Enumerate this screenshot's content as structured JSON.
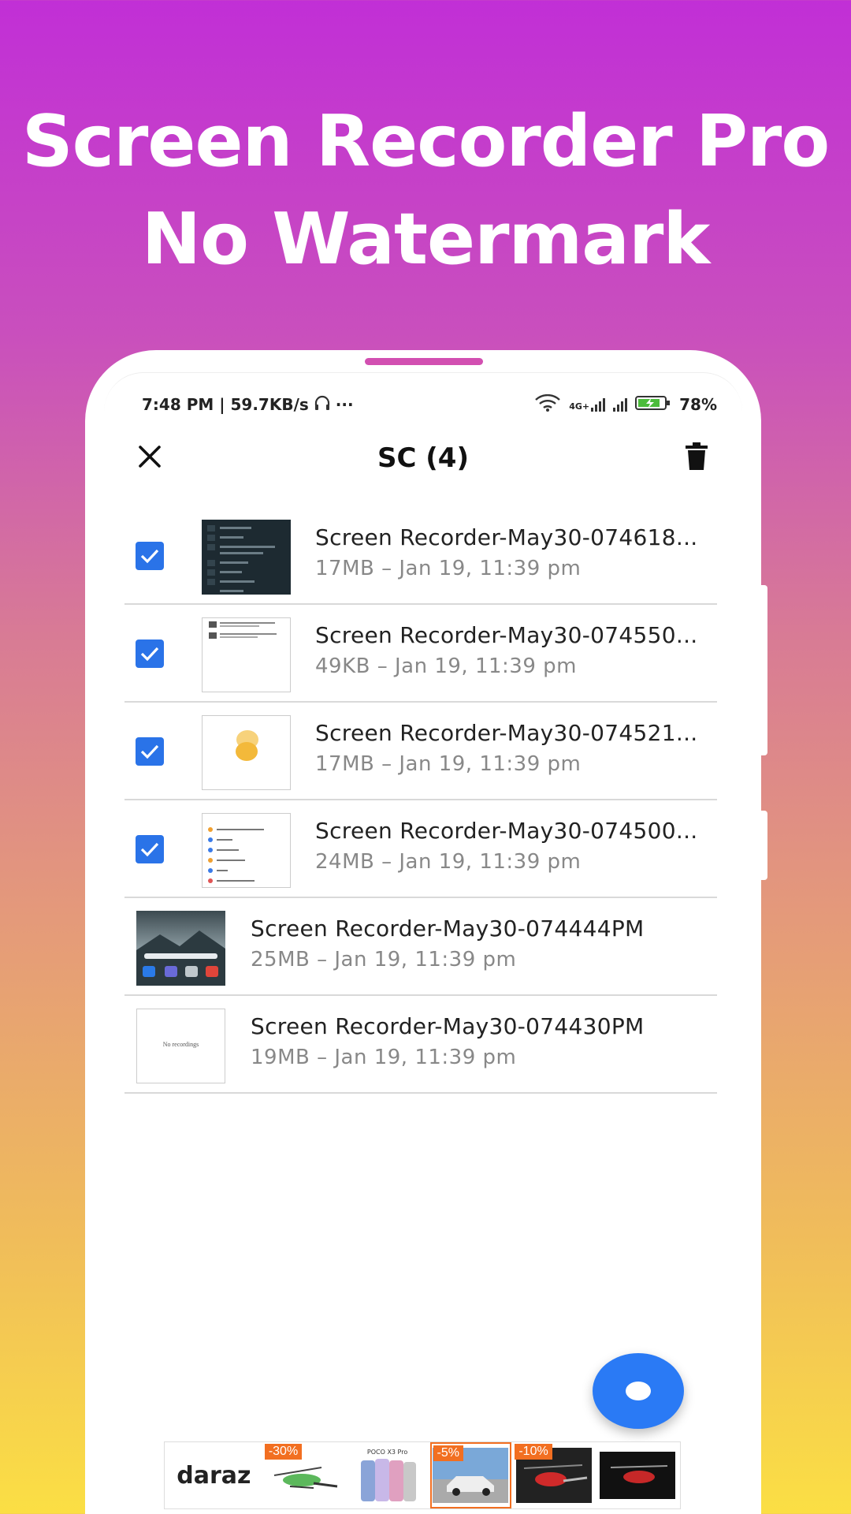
{
  "promo": {
    "line1": "Screen Recorder Pro",
    "line2": "No Watermark"
  },
  "statusbar": {
    "time_speed": "7:48 PM | 59.7KB/s",
    "more": "···",
    "network": "4G+",
    "battery": "78%"
  },
  "toolbar": {
    "title": "SC (4)",
    "close_icon": "close-icon",
    "delete_icon": "trash-icon"
  },
  "recordings": [
    {
      "title": "Screen Recorder-May30-074618...",
      "meta": "17MB – Jan 19, 11:39 pm",
      "selected": true
    },
    {
      "title": "Screen Recorder-May30-074550...",
      "meta": "49KB – Jan 19, 11:39 pm",
      "selected": true
    },
    {
      "title": "Screen Recorder-May30-074521...",
      "meta": "17MB – Jan 19, 11:39 pm",
      "selected": true
    },
    {
      "title": "Screen Recorder-May30-074500...",
      "meta": "24MB – Jan 19, 11:39 pm",
      "selected": true
    },
    {
      "title": "Screen Recorder-May30-074444PM",
      "meta": "25MB – Jan 19, 11:39 pm",
      "selected": false
    },
    {
      "title": "Screen Recorder-May30-074430PM",
      "meta": "19MB – Jan 19, 11:39 pm",
      "selected": false
    }
  ],
  "thumb_text": {
    "no_recordings": "No recordings"
  },
  "ad": {
    "brand": "daraz",
    "badges": [
      "-30%",
      "-5%",
      "-10%"
    ],
    "product_caption": "POCO X3 Pro"
  },
  "colors": {
    "accent": "#2a73e8",
    "fab": "#2a7af5",
    "ad_badge": "#f26f21"
  }
}
